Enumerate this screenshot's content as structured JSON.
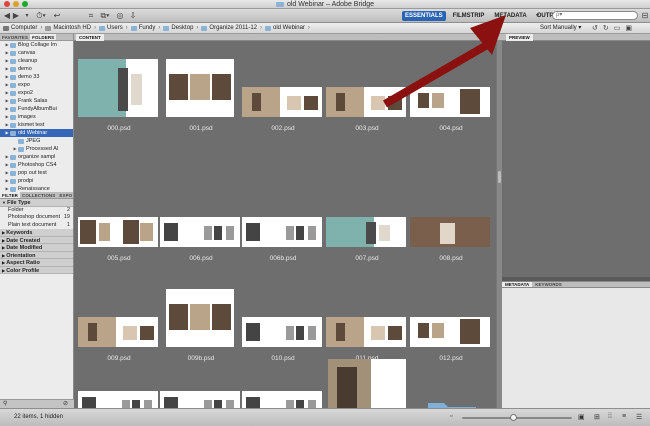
{
  "window": {
    "title": "old Webinar – Adobe Bridge"
  },
  "toolbar": {
    "workspaces": [
      "ESSENTIALS",
      "FILMSTRIP",
      "METADATA",
      "OUTPUT"
    ],
    "active_workspace": "ESSENTIALS",
    "search_placeholder": "ρ▾"
  },
  "path": {
    "crumbs": [
      "Computer",
      "Macintosh HD",
      "Users",
      "Fundy",
      "Desktop",
      "Organize 2011-12",
      "old Webinar"
    ],
    "sort_label": "Sort Manually ▾"
  },
  "left_panel": {
    "tabs": [
      "FAVORITES",
      "FOLDERS"
    ],
    "active_tab": "FOLDERS",
    "folders": [
      {
        "name": "Blog Collage Im",
        "indent": 1,
        "expand": true
      },
      {
        "name": "canvas",
        "indent": 1,
        "expand": true
      },
      {
        "name": "cleanup",
        "indent": 1,
        "expand": true
      },
      {
        "name": "demo",
        "indent": 1,
        "expand": true
      },
      {
        "name": "demo 33",
        "indent": 1,
        "expand": true
      },
      {
        "name": "expo",
        "indent": 1,
        "expand": true
      },
      {
        "name": "expo2",
        "indent": 1,
        "expand": true
      },
      {
        "name": "Frank Salas",
        "indent": 1,
        "expand": true
      },
      {
        "name": "FundyAlbumBui",
        "indent": 1,
        "expand": true
      },
      {
        "name": "images",
        "indent": 1,
        "expand": true
      },
      {
        "name": "kismet test",
        "indent": 1,
        "expand": true
      },
      {
        "name": "old Webinar",
        "indent": 1,
        "expand": true,
        "selected": true
      },
      {
        "name": "JPEG",
        "indent": 2,
        "expand": false
      },
      {
        "name": "Processed Al",
        "indent": 2,
        "expand": true
      },
      {
        "name": "organize sampl",
        "indent": 1,
        "expand": true
      },
      {
        "name": "Photoshop CS4",
        "indent": 1,
        "expand": true
      },
      {
        "name": "pop out test",
        "indent": 1,
        "expand": true
      },
      {
        "name": "prodpi",
        "indent": 1,
        "expand": true
      },
      {
        "name": "Renaissance",
        "indent": 1,
        "expand": true
      }
    ],
    "filter_tabs": [
      "FILTER",
      "COLLECTIONS",
      "EXPO"
    ],
    "active_filter_tab": "FILTER",
    "filter_sections": [
      {
        "title": "File Type",
        "open": true,
        "items": [
          {
            "label": "Folder",
            "count": "2"
          },
          {
            "label": "Photoshop document",
            "count": "19"
          },
          {
            "label": "Plain text document",
            "count": "1"
          }
        ]
      },
      {
        "title": "Keywords",
        "open": false,
        "items": []
      },
      {
        "title": "Date Created",
        "open": false,
        "items": []
      },
      {
        "title": "Date Modified",
        "open": false,
        "items": []
      },
      {
        "title": "Orientation",
        "open": false,
        "items": []
      },
      {
        "title": "Aspect Ratio",
        "open": false,
        "items": []
      },
      {
        "title": "Color Profile",
        "open": false,
        "items": []
      }
    ]
  },
  "content": {
    "tab": "CONTENT",
    "thumbnails": [
      {
        "label": "000.psd",
        "style": "spread-big"
      },
      {
        "label": "001.psd",
        "style": "triple"
      },
      {
        "label": "002.psd",
        "style": "split"
      },
      {
        "label": "003.psd",
        "style": "split2"
      },
      {
        "label": "004.psd",
        "style": "pair"
      },
      {
        "label": "005.psd",
        "style": "couple"
      },
      {
        "label": "006.psd",
        "style": "bw"
      },
      {
        "label": "006b.psd",
        "style": "bw2"
      },
      {
        "label": "007.psd",
        "style": "wide"
      },
      {
        "label": "008.psd",
        "style": "dark"
      },
      {
        "label": "009.psd",
        "style": "split"
      },
      {
        "label": "009b.psd",
        "style": "triple"
      },
      {
        "label": "010.psd",
        "style": "bw"
      },
      {
        "label": "011.psd",
        "style": "split2"
      },
      {
        "label": "012.psd",
        "style": "pair"
      },
      {
        "label": "",
        "style": "bw2"
      },
      {
        "label": "",
        "style": "bw"
      },
      {
        "label": "",
        "style": "bw2"
      },
      {
        "label": "",
        "style": "portrait"
      },
      {
        "label": "",
        "style": "folder"
      }
    ]
  },
  "right_panel": {
    "preview_tab": "PREVIEW",
    "meta_tabs": [
      "METADATA",
      "KEYWORDS"
    ],
    "active_meta_tab": "METADATA"
  },
  "status": {
    "text": "22 items, 1 hidden"
  },
  "colors": {
    "accent": "#2a64b4",
    "arrow": "#8b1010",
    "content_bg": "#6e6e6e"
  }
}
